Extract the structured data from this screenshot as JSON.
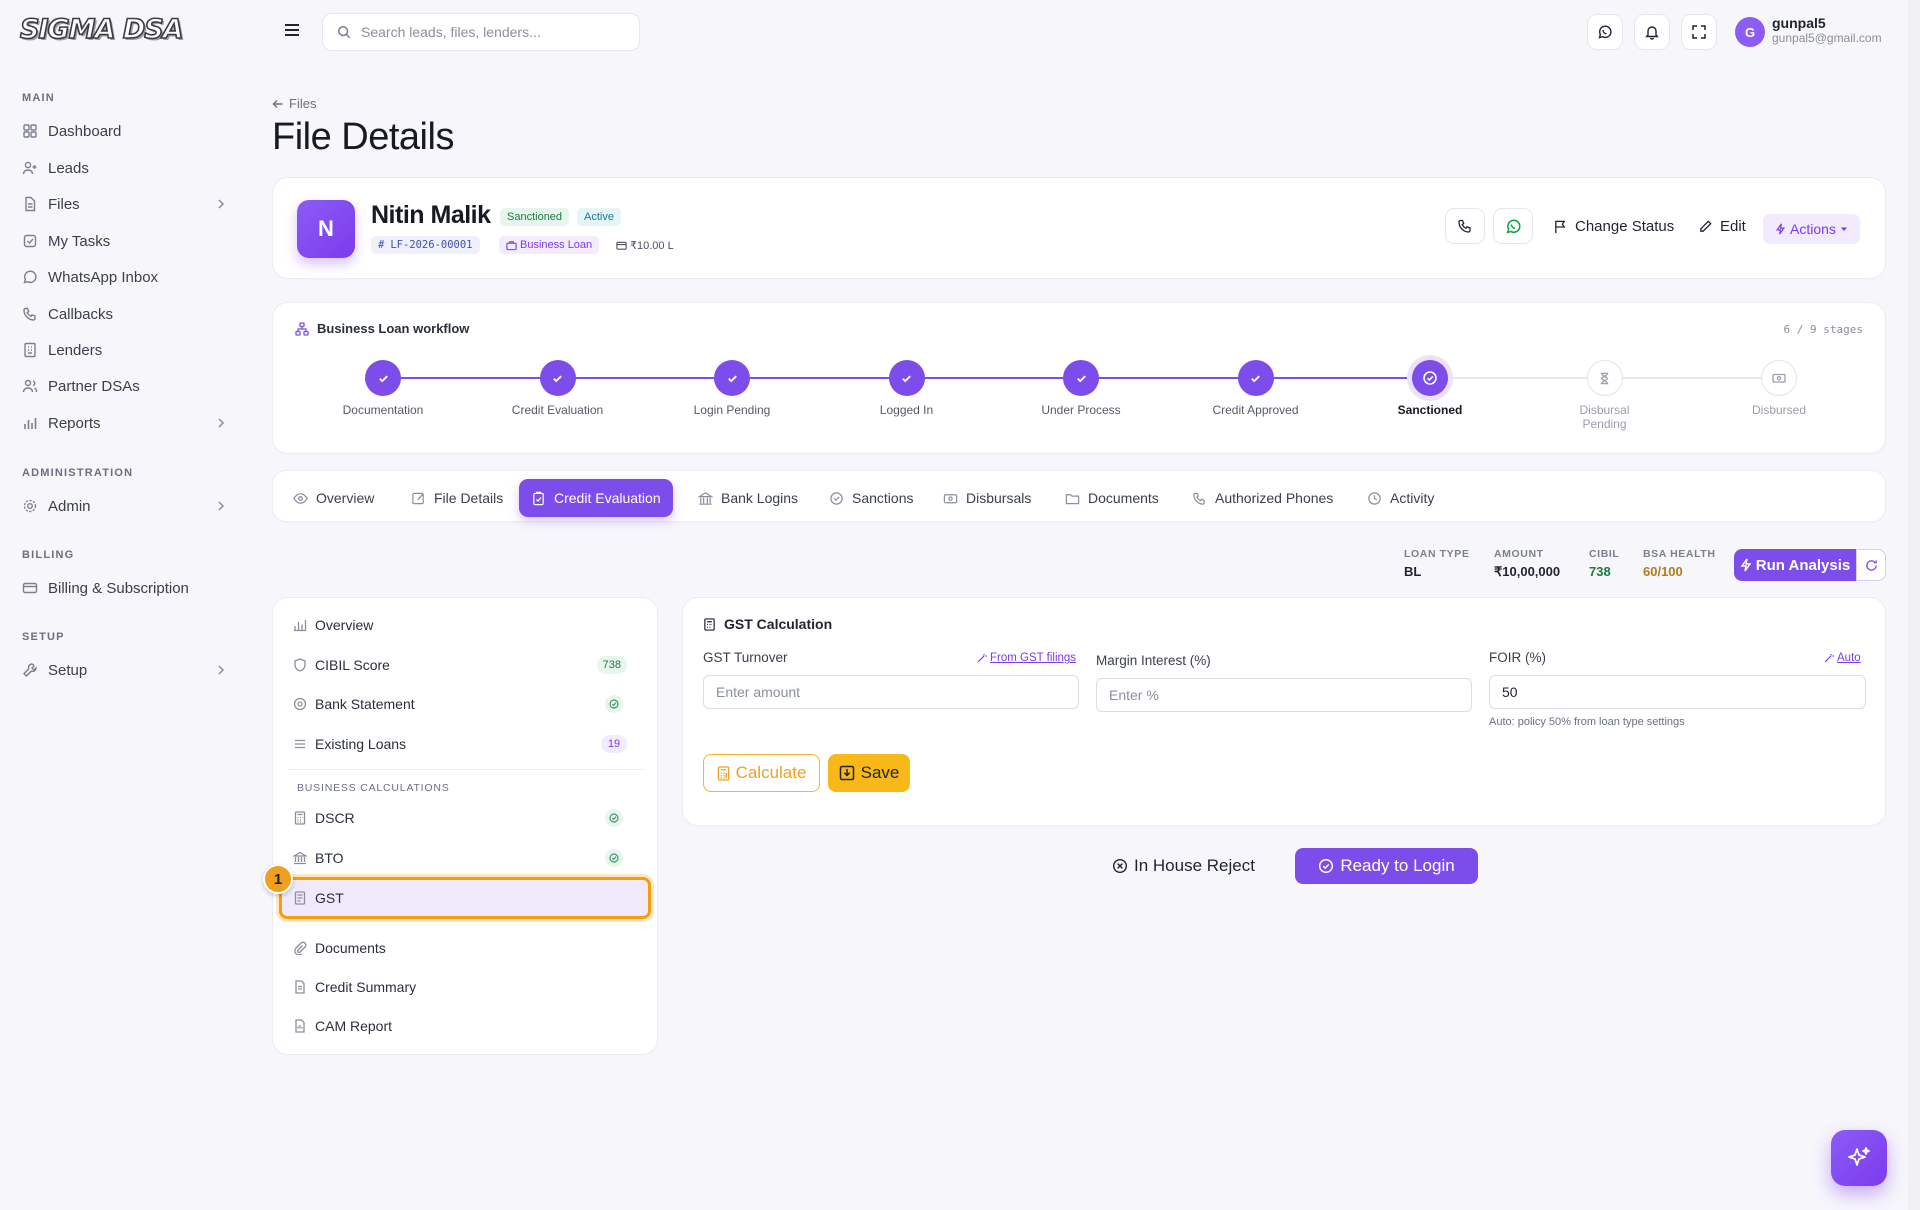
{
  "app": {
    "logo": "SIGMA DSA"
  },
  "sidebar": {
    "sections": [
      {
        "label": "MAIN"
      },
      {
        "label": "ADMINISTRATION"
      },
      {
        "label": "BILLING"
      },
      {
        "label": "SETUP"
      }
    ],
    "items": [
      {
        "label": "Dashboard",
        "icon": "grid-icon"
      },
      {
        "label": "Leads",
        "icon": "user-plus-icon"
      },
      {
        "label": "Files",
        "icon": "file-icon",
        "expandable": true
      },
      {
        "label": "My Tasks",
        "icon": "task-icon"
      },
      {
        "label": "WhatsApp Inbox",
        "icon": "whatsapp-icon"
      },
      {
        "label": "Callbacks",
        "icon": "phone-icon"
      },
      {
        "label": "Lenders",
        "icon": "building-icon"
      },
      {
        "label": "Partner DSAs",
        "icon": "users-icon"
      },
      {
        "label": "Reports",
        "icon": "bar-chart-icon",
        "expandable": true
      },
      {
        "label": "Admin",
        "icon": "gear-icon",
        "expandable": true
      },
      {
        "label": "Billing & Subscription",
        "icon": "credit-card-icon"
      },
      {
        "label": "Setup",
        "icon": "wrench-icon",
        "expandable": true
      }
    ]
  },
  "topbar": {
    "search_placeholder": "Search leads, files, lenders...",
    "user": {
      "initial": "G",
      "name": "gunpal5",
      "email": "gunpal5@gmail.com"
    }
  },
  "header": {
    "breadcrumb": "Files",
    "title": "File Details"
  },
  "lead": {
    "initial": "N",
    "name": "Nitin Malik",
    "status": "Sanctioned",
    "state": "Active",
    "file_id": "LF-2026-00001",
    "loan_type": "Business Loan",
    "amount": "₹10.00 L",
    "change_status_label": "Change Status",
    "edit_label": "Edit",
    "actions_label": "Actions"
  },
  "workflow": {
    "title": "Business Loan workflow",
    "count": "6 / 9 stages",
    "stages": [
      {
        "label": "Documentation",
        "state": "done"
      },
      {
        "label": "Credit Evaluation",
        "state": "done"
      },
      {
        "label": "Login Pending",
        "state": "done"
      },
      {
        "label": "Logged In",
        "state": "done"
      },
      {
        "label": "Under Process",
        "state": "done"
      },
      {
        "label": "Credit Approved",
        "state": "done"
      },
      {
        "label": "Sanctioned",
        "state": "current"
      },
      {
        "label": "Disbursal Pending",
        "state": "todo"
      },
      {
        "label": "Disbursed",
        "state": "todo"
      }
    ]
  },
  "tabs": [
    {
      "label": "Overview",
      "icon": "eye-icon"
    },
    {
      "label": "File Details",
      "icon": "edit-icon"
    },
    {
      "label": "Credit Evaluation",
      "icon": "clipboard-check-icon",
      "active": true
    },
    {
      "label": "Bank Logins",
      "icon": "bank-icon"
    },
    {
      "label": "Sanctions",
      "icon": "check-circle-icon"
    },
    {
      "label": "Disbursals",
      "icon": "cash-icon"
    },
    {
      "label": "Documents",
      "icon": "folder-icon"
    },
    {
      "label": "Authorized Phones",
      "icon": "phone-icon"
    },
    {
      "label": "Activity",
      "icon": "clock-icon"
    }
  ],
  "metrics": {
    "loan_type": {
      "label": "LOAN TYPE",
      "value": "BL"
    },
    "amount": {
      "label": "AMOUNT",
      "value": "₹10,00,000"
    },
    "cibil": {
      "label": "CIBIL",
      "value": "738"
    },
    "bsa": {
      "label": "BSA HEALTH",
      "value": "60/100"
    },
    "run_label": "Run Analysis"
  },
  "credit_nav": {
    "items": [
      {
        "label": "Overview",
        "icon": "chart-icon"
      },
      {
        "label": "CIBIL Score",
        "icon": "shield-icon",
        "badge": "738"
      },
      {
        "label": "Bank Statement",
        "icon": "bank-statement-icon",
        "check": true
      },
      {
        "label": "Existing Loans",
        "icon": "list-icon",
        "badge": "19"
      }
    ],
    "section_label": "BUSINESS CALCULATIONS",
    "calc_items": [
      {
        "label": "DSCR",
        "icon": "calculator-icon",
        "check": true
      },
      {
        "label": "BTO",
        "icon": "bank-icon",
        "check": true
      },
      {
        "label": "GST",
        "icon": "receipt-icon",
        "active": true
      }
    ],
    "other_items": [
      {
        "label": "Documents",
        "icon": "paperclip-icon"
      },
      {
        "label": "Credit Summary",
        "icon": "document-icon"
      },
      {
        "label": "CAM Report",
        "icon": "report-icon"
      }
    ],
    "step_marker": "1"
  },
  "gst": {
    "title": "GST Calculation",
    "turnover_label": "GST Turnover",
    "turnover_link": "From GST filings",
    "turnover_placeholder": "Enter amount",
    "margin_label": "Margin Interest (%)",
    "margin_placeholder": "Enter %",
    "foir_label": "FOIR (%)",
    "foir_link": "Auto",
    "foir_value": "50",
    "foir_hint": "Auto: policy 50% from loan type settings",
    "calculate_label": "Calculate",
    "save_label": "Save"
  },
  "footer_actions": {
    "reject_label": "In House Reject",
    "ready_label": "Ready to Login"
  },
  "colors": {
    "accent": "#7c4dea",
    "amber": "#f7b818",
    "success": "#1d7a43",
    "warning": "#b7791f"
  }
}
